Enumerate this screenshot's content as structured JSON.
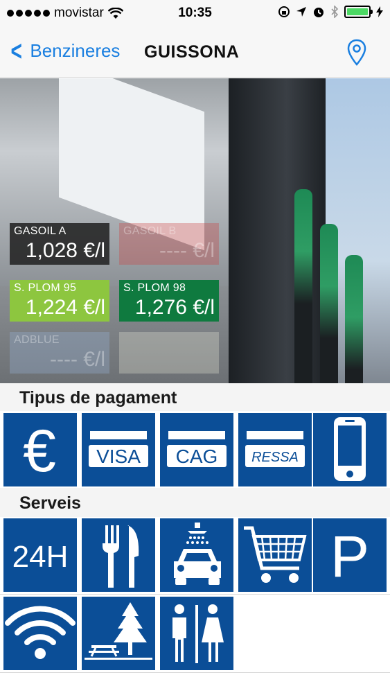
{
  "status_bar": {
    "carrier": "movistar",
    "time": "10:35",
    "battery_color": "#4cd964"
  },
  "nav": {
    "back_label": "Benzineres",
    "title": "GUISSONA",
    "location_icon": "map-pin-icon"
  },
  "prices": [
    {
      "label": "GASOIL A",
      "value": "1,028 €/l",
      "style": "dark"
    },
    {
      "label": "GASOIL B",
      "value": "---- €/l",
      "style": "ghost-red"
    },
    {
      "label": "S. PLOM 95",
      "value": "1,224 €/l",
      "style": "lime"
    },
    {
      "label": "S. PLOM 98",
      "value": "1,276 €/l",
      "style": "green"
    },
    {
      "label": "ADBLUE",
      "value": "---- €/l",
      "style": "ghost-blue"
    }
  ],
  "payment": {
    "title": "Tipus de pagament",
    "items": [
      {
        "icon": "euro-icon",
        "label": "€"
      },
      {
        "icon": "visa-card-icon",
        "label": "VISA"
      },
      {
        "icon": "cag-card-icon",
        "label": "CAG"
      },
      {
        "icon": "ressa-card-icon",
        "label": "RESSA"
      },
      {
        "icon": "mobile-phone-icon",
        "label": ""
      }
    ]
  },
  "services": {
    "title": "Serveis",
    "items": [
      {
        "icon": "24h-icon",
        "label": "24H"
      },
      {
        "icon": "restaurant-icon",
        "label": ""
      },
      {
        "icon": "car-wash-icon",
        "label": ""
      },
      {
        "icon": "shop-cart-icon",
        "label": ""
      },
      {
        "icon": "parking-icon",
        "label": "P"
      },
      {
        "icon": "wifi-icon",
        "label": ""
      },
      {
        "icon": "picnic-area-icon",
        "label": ""
      },
      {
        "icon": "toilets-icon",
        "label": ""
      }
    ]
  },
  "colors": {
    "tile_blue": "#0b4e97",
    "ios_blue": "#1a7fe0",
    "lime": "#8dc63f",
    "green": "#0f7a3f"
  }
}
